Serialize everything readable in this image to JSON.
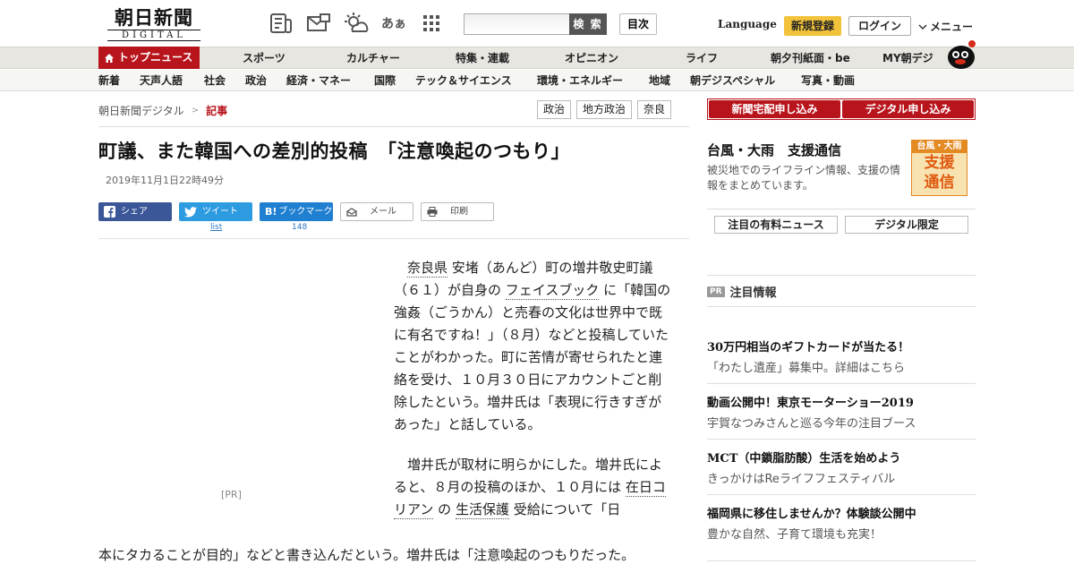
{
  "header": {
    "logo_main": "朝日新聞",
    "logo_sub": "DIGITAL",
    "icons": [
      "newspaper-icon",
      "mail-ticket-icon",
      "weather-icon",
      "font-size-icon",
      "grid-icon"
    ],
    "font_glyph": "あぁ",
    "search_placeholder": "",
    "search_label": "検 索",
    "toc_label": "目次",
    "language_label": "Language",
    "register_label": "新規登録",
    "login_label": "ログイン",
    "menu_label": "メニュー"
  },
  "nav_primary": [
    {
      "label": "トップニュース",
      "active": true
    },
    {
      "label": "スポーツ"
    },
    {
      "label": "カルチャー"
    },
    {
      "label": "特集・連載"
    },
    {
      "label": "オピニオン"
    },
    {
      "label": "ライフ"
    },
    {
      "label": "朝夕刊紙面・be"
    },
    {
      "label": "MY朝デジ"
    }
  ],
  "nav_secondary": [
    "新着",
    "天声人語",
    "社会",
    "政治",
    "経済・マネー",
    "国際",
    "テック＆サイエンス",
    "環境・エネルギー",
    "地域",
    "朝デジスペシャル",
    "写真・動画"
  ],
  "breadcrumb": {
    "home": "朝日新聞デジタル",
    "separator": ">",
    "current": "記事"
  },
  "tags": [
    "政治",
    "地方政治",
    "奈良"
  ],
  "article": {
    "headline": "町議、また韓国への差別的投稿　「注意喚起のつもり」",
    "date": "2019年11月1日22時49分",
    "share": {
      "facebook": "シェア",
      "twitter": "ツイート",
      "twitter_count": "list",
      "hatena": "ブックマーク",
      "hatena_count": "148",
      "mail": "メール",
      "print": "印刷"
    },
    "ad_label": "[PR]",
    "p1": {
      "link1": "奈良県",
      "text1": " 安堵（あんど）町の増井敬史町議（６１）が自身の ",
      "link2": "フェイスブック",
      "text2": " に「韓国の強姦（ごうかん）と売春の文化は世界中で既に有名ですね！」（８月）などと投稿していたことがわかった。町に苦情が寄せられたと連絡を受け、１０月３０日にアカウントごと削除したという。増井氏は「表現に行きすぎがあった」と話している。"
    },
    "p2": {
      "text1": "増井氏が取材に明らかにした。増井氏によると、８月の投稿のほか、１０月には ",
      "link1": "在日コリアン",
      "text2": " の ",
      "link2": "生活保護",
      "text3": " 受給について「日"
    },
    "p2_tail": "本にタカることが目的」などと書き込んだという。増井氏は「注意喚起のつもりだった。"
  },
  "sidebar": {
    "subscribe": [
      "新聞宅配申し込み",
      "デジタル申し込み"
    ],
    "typhoon": {
      "title": "台風・大雨　支援通信",
      "desc": "被災地でのライフライン情報、支援の情報をまとめています。",
      "badge_top": "台風・大雨",
      "badge_main1": "支援",
      "badge_main2": "通信"
    },
    "tabs": [
      "注目の有料ニュース",
      "デジタル限定"
    ],
    "pr_badge": "PR",
    "pr_heading": "注目情報",
    "pr_items": [
      {
        "title": "30万円相当のギフトカードが当たる！",
        "sub": "「わたし遺産」募集中。詳細はこちら"
      },
      {
        "title": "動画公開中！東京モーターショー2019",
        "sub": "宇賀なつみさんと巡る今年の注目ブース"
      },
      {
        "title": "MCT（中鎖脂肪酸）生活を始めよう",
        "sub": "きっかけはReライフフェスティバル"
      },
      {
        "title": "福岡県に移住しませんか？体験談公開中",
        "sub": "豊かな自然、子育て環境も充実！"
      }
    ]
  },
  "colors": {
    "brand_red": "#b8141c",
    "facebook": "#3b5798",
    "twitter": "#2d9be0",
    "hatena": "#1f7fd1",
    "register": "#f2c23b",
    "typhoon_orange": "#e38a22"
  }
}
